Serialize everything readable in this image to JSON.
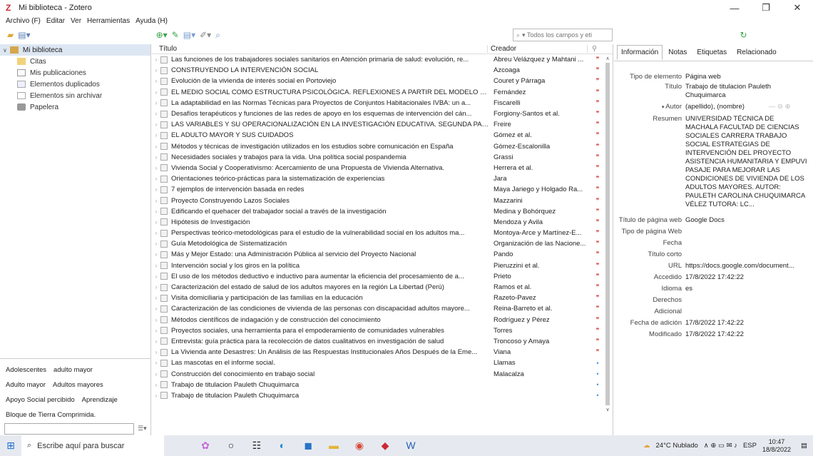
{
  "window": {
    "title": "Mi biblioteca - Zotero"
  },
  "menu": [
    "Archivo (F)",
    "Editar",
    "Ver",
    "Herramientas",
    "Ayuda (H)"
  ],
  "search": {
    "placeholder": "▾ Todos los campos y eti"
  },
  "collections": {
    "root": "Mi biblioteca",
    "items": [
      "Citas",
      "Mis publicaciones",
      "Elementos duplicados",
      "Elementos sin archivar",
      "Papelera"
    ]
  },
  "tags": {
    "rows": [
      [
        "Adolescentes",
        "adulto mayor"
      ],
      [
        "Adulto mayor",
        "Adultos mayores"
      ],
      [
        "Apoyo Social percibido",
        "Aprendizaje"
      ],
      [
        "Bloque de Tierra Comprimida."
      ]
    ]
  },
  "items_header": {
    "title": "Título",
    "creator": "Creador",
    "attach": "⚲"
  },
  "items": [
    {
      "title": "Las funciones de los trabajadores sociales sanitarios en Atención primaria de salud: evolución, re...",
      "creator": "Abreu Velázquez y Mahtani ...",
      "dot": "red"
    },
    {
      "title": "CONSTRUYENDO LA INTERVENCIÓN SOCIAL",
      "creator": "Azcoaga",
      "dot": "red"
    },
    {
      "title": "Evolución de la vivienda de interés social en Portoviejo",
      "creator": "Couret y Párraga",
      "dot": "red"
    },
    {
      "title": "EL MEDIO SOCIAL COMO ESTRUCTURA PSICOLÓGICA. REFLEXIONES A PARTIR DEL MODELO EC...",
      "creator": "Fernández",
      "dot": "red"
    },
    {
      "title": "La adaptabilidad en las Normas Técnicas para Proyectos de Conjuntos Habitacionales IVBA: un a...",
      "creator": "Fiscarelli",
      "dot": "red"
    },
    {
      "title": "Desafíos terapéuticos y funciones de las redes de apoyo en los esquemas de intervención del cán...",
      "creator": "Forgiony-Santos et al.",
      "dot": "red"
    },
    {
      "title": "LAS VARIABLES Y SU OPERACIONALIZACIÓN EN LA INVESTIGACIÓN EDUCATIVA. SEGUNDA PARTE",
      "creator": "Freire",
      "dot": "red"
    },
    {
      "title": "EL ADULTO MAYOR Y SUS CUIDADOS",
      "creator": "Gómez et al.",
      "dot": "red"
    },
    {
      "title": "Métodos y técnicas de investigación utilizados en los estudios sobre comunicación en España",
      "creator": "Gómez-Escalonilla",
      "dot": "red"
    },
    {
      "title": "Necesidades sociales y trabajos para la vida. Una política social pospandemia",
      "creator": "Grassi",
      "dot": "red"
    },
    {
      "title": "Vivienda Social y Cooperativismo: Acercamiento de una Propuesta de Vivienda Alternativa.",
      "creator": "Herrera et al.",
      "dot": "red"
    },
    {
      "title": "Orientaciones teórico-prácticas para la sistematización de experiencias",
      "creator": "Jara",
      "dot": "red"
    },
    {
      "title": "7 ejemplos de intervención basada en redes",
      "creator": "Maya Jariego y Holgado Ra...",
      "dot": "red"
    },
    {
      "title": "Proyecto Construyendo Lazos Sociales",
      "creator": "Mazzarini",
      "dot": "red"
    },
    {
      "title": "Edificando el quehacer del trabajador social a través de la investigación",
      "creator": "Medina y Bohórquez",
      "dot": "red"
    },
    {
      "title": "Hipótesis de Investigación",
      "creator": "Mendoza y Avila",
      "dot": "red"
    },
    {
      "title": "Perspectivas teórico-metodológicas para el estudio de la vulnerabilidad social en los adultos ma...",
      "creator": "Montoya-Arce y Martínez-E...",
      "dot": "red"
    },
    {
      "title": "Guía Metodológica de Sistematización",
      "creator": "Organización de las Nacione...",
      "dot": "red"
    },
    {
      "title": "Más y Mejor Estado: una Administración Pública al servicio del Proyecto Nacional",
      "creator": "Pando",
      "dot": "red"
    },
    {
      "title": "Intervención social y los giros en la política",
      "creator": "Pieruzzini et al.",
      "dot": "red"
    },
    {
      "title": "El uso de los métodos deductivo e inductivo para aumentar la eficiencia del procesamiento de a...",
      "creator": "Prieto",
      "dot": "red"
    },
    {
      "title": "Caracterización del estado de salud de los adultos mayores en la región La Libertad (Perú)",
      "creator": "Ramos et al.",
      "dot": "red"
    },
    {
      "title": "Visita domiciliaria y participación de las familias en la educación",
      "creator": "Razeto-Pavez",
      "dot": "red"
    },
    {
      "title": "Caracterización de las condiciones de vivienda de las personas con discapacidad adultos mayore...",
      "creator": "Reina-Barreto et al.",
      "dot": "red"
    },
    {
      "title": "Métodos científicos de indagación y de construcción del conocimiento",
      "creator": "Rodríguez y Pérez",
      "dot": "red"
    },
    {
      "title": "Proyectos sociales, una herramienta para el empoderamiento de comunidades vulnerables",
      "creator": "Torres",
      "dot": "red"
    },
    {
      "title": "Entrevista: guía práctica para la recolección de datos cualitativos en investigación de salud",
      "creator": "Troncoso y Amaya",
      "dot": "red"
    },
    {
      "title": "La Vivienda ante Desastres: Un Análisis de las Respuestas Institucionales Años Después de la Eme...",
      "creator": "Viana",
      "dot": "red"
    },
    {
      "title": "Las mascotas en el informe social.",
      "creator": "Llamas",
      "dot": "blue"
    },
    {
      "title": "Construcción del conocimiento en trabajo social",
      "creator": "Malacalza",
      "dot": "blue"
    },
    {
      "title": "Trabajo de titulacion Pauleth Chuquimarca",
      "creator": "",
      "dot": "blue"
    },
    {
      "title": "Trabajo de titulacion Pauleth Chuquimarca",
      "creator": "",
      "dot": "blue"
    }
  ],
  "tabs": [
    "Información",
    "Notas",
    "Etiquetas",
    "Relacionado"
  ],
  "info": {
    "tipo_label": "Tipo de elemento",
    "tipo": "Página web",
    "titulo_label": "Título",
    "titulo": "Trabajo de titulacion Pauleth Chuquimarca",
    "autor_label": "Autor",
    "autor": "(apellido), (nombre)",
    "resumen_label": "Resumen",
    "resumen": "UNIVERSIDAD TÉCNICA DE MACHALA FACULTAD DE CIENCIAS SOCIALES CARRERA TRABAJO SOCIAL ESTRATEGIAS DE INTERVENCIÓN DEL PROYECTO ASISTENCIA HUMANITARIA Y EMPUVI PASAJE PARA MEJORAR LAS CONDICIONES DE VIVIENDA DE LOS ADULTOS MAYORES. AUTOR: PAULETH CAROLINA CHUQUIMARCA VÉLEZ TUTORA: LC...",
    "titulo_pagina_label": "Título de página web",
    "titulo_pagina": "Google Docs",
    "tipo_pagina_label": "Tipo de página Web",
    "tipo_pagina": "",
    "fecha_label": "Fecha",
    "fecha": "",
    "titulo_corto_label": "Título corto",
    "titulo_corto": "",
    "url_label": "URL",
    "url": "https://docs.google.com/document...",
    "accedido_label": "Accedido",
    "accedido": "17/8/2022 17:42:22",
    "idioma_label": "Idioma",
    "idioma": "es",
    "derechos_label": "Derechos",
    "derechos": "",
    "adicional_label": "Adicional",
    "adicional": "",
    "fecha_adicion_label": "Fecha de adición",
    "fecha_adicion": "17/8/2022 17:42:22",
    "modificado_label": "Modificado",
    "modificado": "17/8/2022 17:42:22"
  },
  "taskbar": {
    "search": "Escribe aquí para buscar",
    "weather": "24°C Nublado",
    "lang": "ESP",
    "time": "10:47",
    "date": "18/8/2022"
  }
}
